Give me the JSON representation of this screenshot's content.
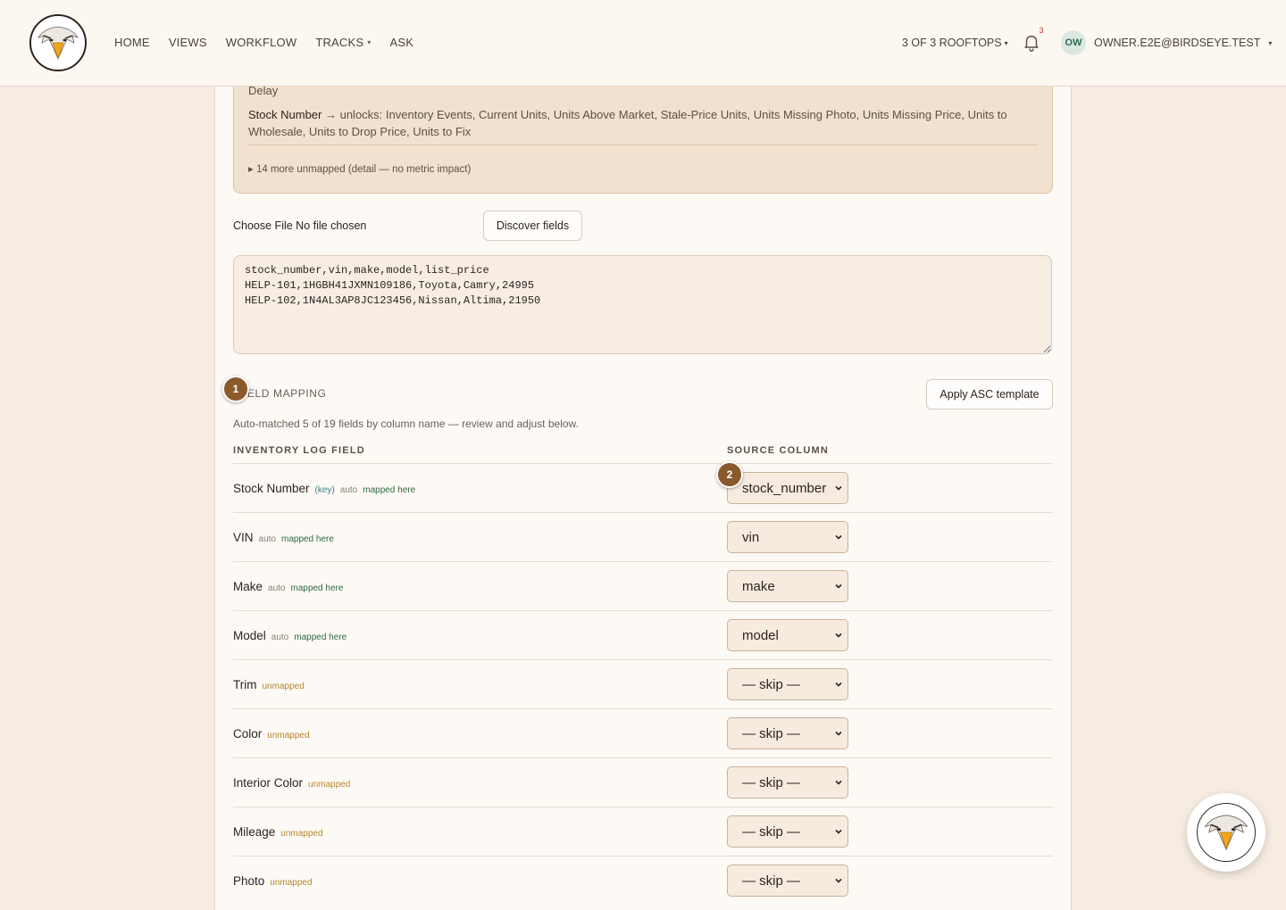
{
  "header": {
    "nav": [
      {
        "label": "HOME"
      },
      {
        "label": "VIEWS"
      },
      {
        "label": "WORKFLOW"
      },
      {
        "label": "TRACKS"
      },
      {
        "label": "ASK"
      }
    ],
    "rooftops": "3 OF 3 ROOFTOPS",
    "notification_count": "3",
    "avatar_initials": "OW",
    "user_email": "OWNER.E2E@BIRDSEYE.TEST"
  },
  "notice": {
    "delay_text": "Delay",
    "unlock_field": "Stock Number",
    "unlock_text": " → unlocks: Inventory Events, Current Units, Units Above Market, Stale-Price Units, Units Missing Photo, Units Missing Price, Units to Wholesale, Units to Drop Price, Units to Fix",
    "more_unmapped": "▸ 14 more unmapped (detail — no metric impact)"
  },
  "file": {
    "label": "Choose File  No file chosen",
    "discover_button": "Discover fields"
  },
  "csv_text": "stock_number,vin,make,model,list_price\nHELP-101,1HGBH41JXMN109186,Toyota,Camry,24995\nHELP-102,1N4AL3AP8JC123456,Nissan,Altima,21950",
  "mapping": {
    "step1": "1",
    "step2": "2",
    "title": "FIELD MAPPING",
    "apply_button": "Apply ASC template",
    "auto_note": "Auto-matched 5 of 19 fields by column name — review and adjust below.",
    "col_field": "INVENTORY LOG FIELD",
    "col_source": "SOURCE COLUMN",
    "rows": [
      {
        "field": "Stock Number",
        "key": "(key)",
        "auto": "auto",
        "status": "mapped here",
        "source": "stock_number"
      },
      {
        "field": "VIN",
        "key": "",
        "auto": "auto",
        "status": "mapped here",
        "source": "vin"
      },
      {
        "field": "Make",
        "key": "",
        "auto": "auto",
        "status": "mapped here",
        "source": "make"
      },
      {
        "field": "Model",
        "key": "",
        "auto": "auto",
        "status": "mapped here",
        "source": "model"
      },
      {
        "field": "Trim",
        "key": "",
        "auto": "",
        "status": "unmapped",
        "source": "— skip —"
      },
      {
        "field": "Color",
        "key": "",
        "auto": "",
        "status": "unmapped",
        "source": "— skip —"
      },
      {
        "field": "Interior Color",
        "key": "",
        "auto": "",
        "status": "unmapped",
        "source": "— skip —"
      },
      {
        "field": "Mileage",
        "key": "",
        "auto": "",
        "status": "unmapped",
        "source": "— skip —"
      },
      {
        "field": "Photo",
        "key": "",
        "auto": "",
        "status": "unmapped",
        "source": "— skip —"
      }
    ]
  }
}
